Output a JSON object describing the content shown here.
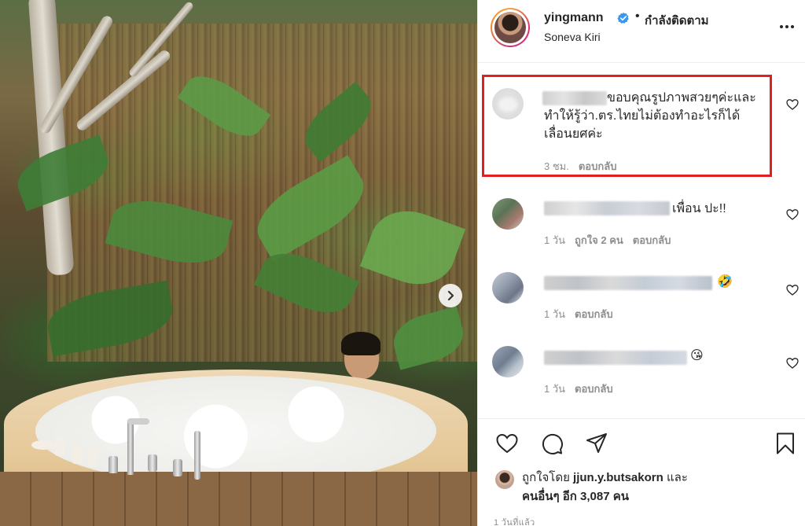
{
  "post": {
    "next_icon": "chevron-right-icon",
    "colors": {
      "highlight": "#e02020",
      "verified": "#3897f0"
    }
  },
  "header": {
    "username": "yingmann",
    "verified_icon": "verified-badge-icon",
    "separator": "•",
    "follow_status": "กำลังติดตาม",
    "location": "Soneva Kiri",
    "more_icon": "more-horizontal-icon"
  },
  "comments": [
    {
      "text_lines": [
        "ขอบคุณรูปภาพสวยๆค่ะและ",
        "ทำให้รู้ว่า.ตร.ไทยไม่ต้องทำอะไรก็ได้",
        "เลื่อนยศค่ะ"
      ],
      "time": "3 ชม.",
      "likes": "",
      "reply": "ตอบกลับ",
      "highlighted": true
    },
    {
      "text": "เพื่อน ปะ!!",
      "time": "1 วัน",
      "likes": "ถูกใจ 2 คน",
      "reply": "ตอบกลับ"
    },
    {
      "text": "🤣",
      "time": "1 วัน",
      "likes": "",
      "reply": "ตอบกลับ"
    },
    {
      "text": "😘",
      "time": "1 วัน",
      "likes": "",
      "reply": "ตอบกลับ"
    }
  ],
  "actions": {
    "like_icon": "heart-icon",
    "comment_icon": "comment-bubble-icon",
    "share_icon": "paper-plane-icon",
    "save_icon": "bookmark-icon"
  },
  "likes": {
    "prefix": "ถูกใจโดย",
    "user": "jjun.y.butsakorn",
    "conj": "และ",
    "others": "คนอื่นๆ อีก 3,087 คน"
  },
  "timestamp": "1 วันที่แล้ว"
}
